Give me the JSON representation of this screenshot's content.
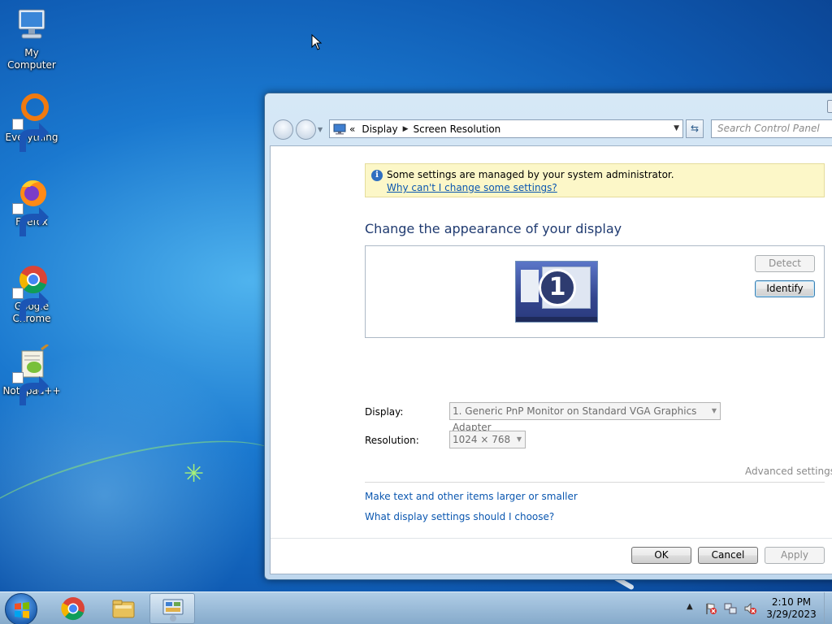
{
  "desktop": {
    "icons": [
      {
        "label": "My Computer",
        "icon": "computer-icon"
      },
      {
        "label": "Everything",
        "icon": "everything-icon"
      },
      {
        "label": "Firefox",
        "icon": "firefox-icon"
      },
      {
        "label": "Google Chrome",
        "icon": "chrome-icon"
      },
      {
        "label": "Notepad++",
        "icon": "notepadpp-icon"
      }
    ]
  },
  "window": {
    "address": {
      "overflow": "«",
      "crumbs": [
        "Display",
        "Screen Resolution"
      ]
    },
    "search_placeholder": "Search Control Panel",
    "infobar": {
      "message": "Some settings are managed by your system administrator.",
      "link": "Why can't I change some settings?"
    },
    "heading": "Change the appearance of your display",
    "monitor_number": "1",
    "buttons": {
      "detect": "Detect",
      "identify": "Identify",
      "ok": "OK",
      "cancel": "Cancel",
      "apply": "Apply"
    },
    "display_label": "Display:",
    "display_value": "1. Generic PnP Monitor on Standard VGA Graphics Adapter",
    "resolution_label": "Resolution:",
    "resolution_value": "1024 × 768",
    "advanced_settings": "Advanced settings",
    "links": [
      "Make text and other items larger or smaller",
      "What display settings should I choose?"
    ]
  },
  "taskbar": {
    "pinned": [
      "start-orb",
      "chrome",
      "file-explorer",
      "control-panel"
    ],
    "clock_time": "2:10 PM",
    "clock_date": "3/29/2023",
    "colors": {
      "accent": "#1f3a70",
      "link": "#0b57b0",
      "infobar": "#fcf7c8"
    }
  }
}
